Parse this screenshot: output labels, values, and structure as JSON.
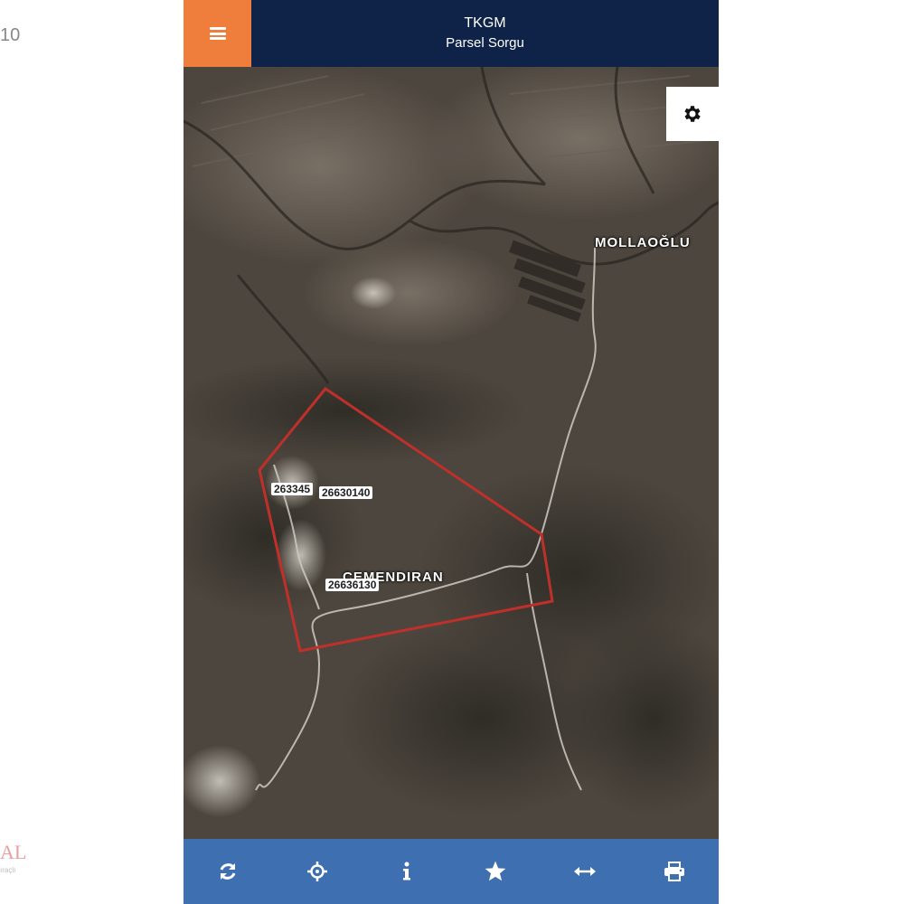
{
  "edge": {
    "left_number": "10",
    "logo_fragment": "AL",
    "logo_sub": "ıraçlı"
  },
  "header": {
    "title": "TKGM",
    "subtitle": "Parsel Sorgu"
  },
  "map": {
    "place_labels": {
      "village_1": "MOLLAOĞLU",
      "village_2": "ÇEMENDIRAN"
    },
    "parcel_labels": {
      "parcel_1": "263345",
      "parcel_2": "26630140",
      "parcel_3": "26636130"
    },
    "parcel_outline_color": "#c0302b"
  },
  "icons": {
    "menu": "hamburger-icon",
    "settings": "gear-icon",
    "toolbar": [
      "refresh-icon",
      "crosshair-icon",
      "info-icon",
      "star-icon",
      "arrows-horizontal-icon",
      "print-icon"
    ]
  },
  "colors": {
    "header_bg": "#0e2347",
    "menu_bg": "#ef7d3b",
    "toolbar_bg": "#3e6fb0",
    "parcel_outline": "#c0302b"
  }
}
